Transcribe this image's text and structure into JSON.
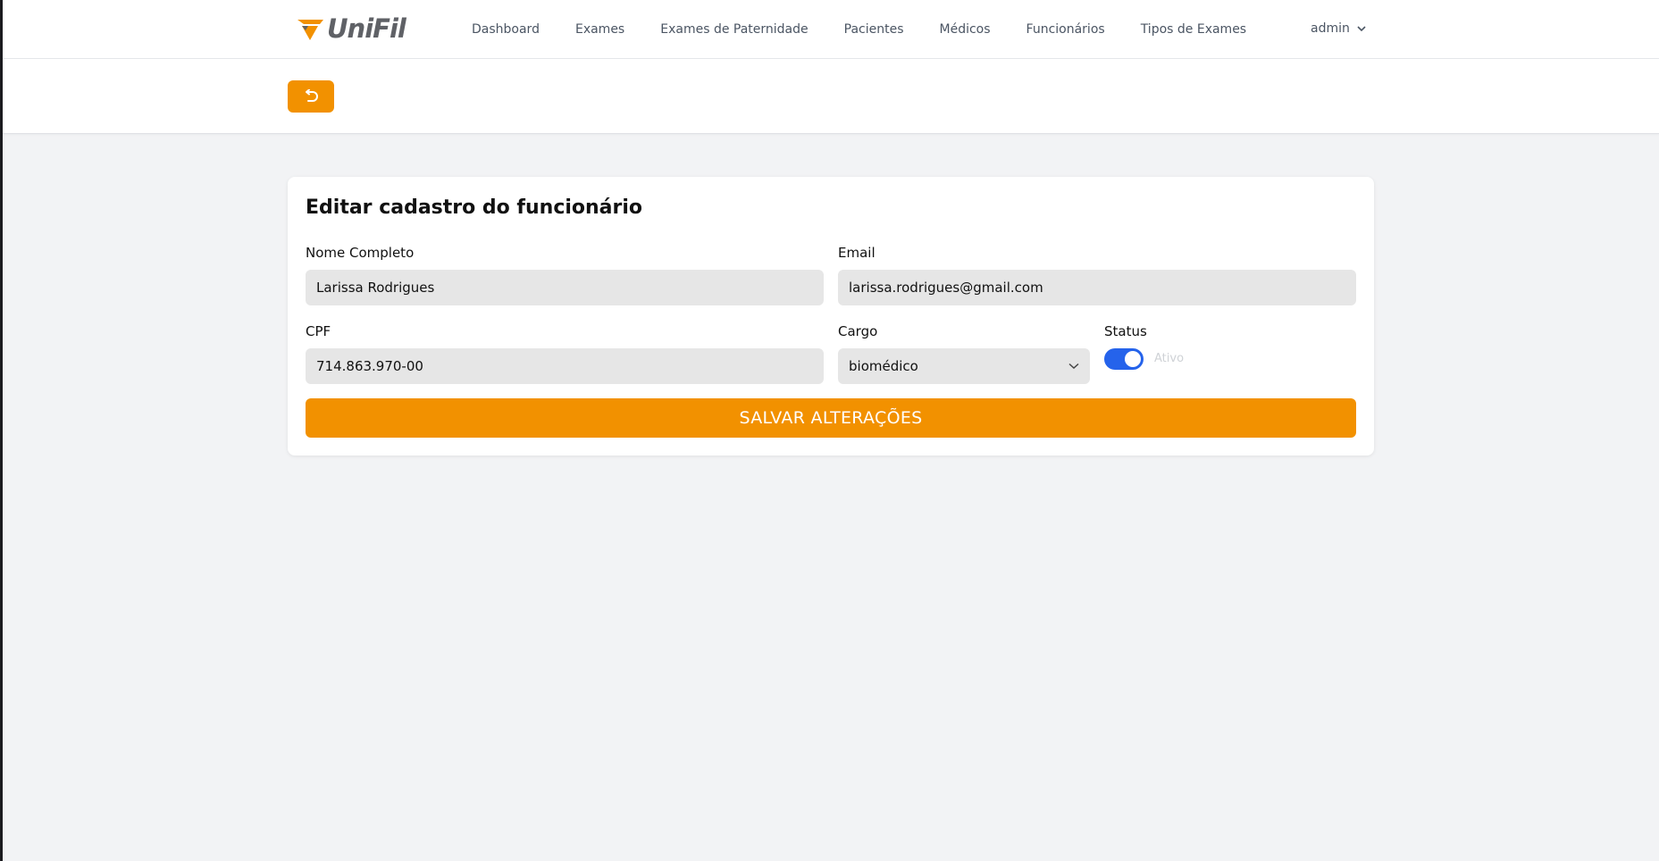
{
  "brand": {
    "name": "UniFil",
    "accent": "#f29100",
    "text_color": "#5f6166"
  },
  "nav": {
    "items": [
      {
        "label": "Dashboard"
      },
      {
        "label": "Exames"
      },
      {
        "label": "Exames de Paternidade"
      },
      {
        "label": "Pacientes"
      },
      {
        "label": "Médicos"
      },
      {
        "label": "Funcionários"
      },
      {
        "label": "Tipos de Exames"
      }
    ]
  },
  "user_menu": {
    "label": "admin",
    "icon": "chevron-down-icon"
  },
  "back_button": {
    "icon": "undo-arrow-icon"
  },
  "form": {
    "title": "Editar cadastro do funcionário",
    "nome": {
      "label": "Nome Completo",
      "value": "Larissa Rodrigues"
    },
    "email": {
      "label": "Email",
      "value": "larissa.rodrigues@gmail.com"
    },
    "cpf": {
      "label": "CPF",
      "value": "714.863.970-00"
    },
    "cargo": {
      "label": "Cargo",
      "value": "biomédico"
    },
    "status": {
      "label": "Status",
      "enabled": true,
      "text": "Ativo",
      "toggle_color": "#2563eb"
    },
    "save_label": "SALVAR ALTERAÇÕES"
  }
}
